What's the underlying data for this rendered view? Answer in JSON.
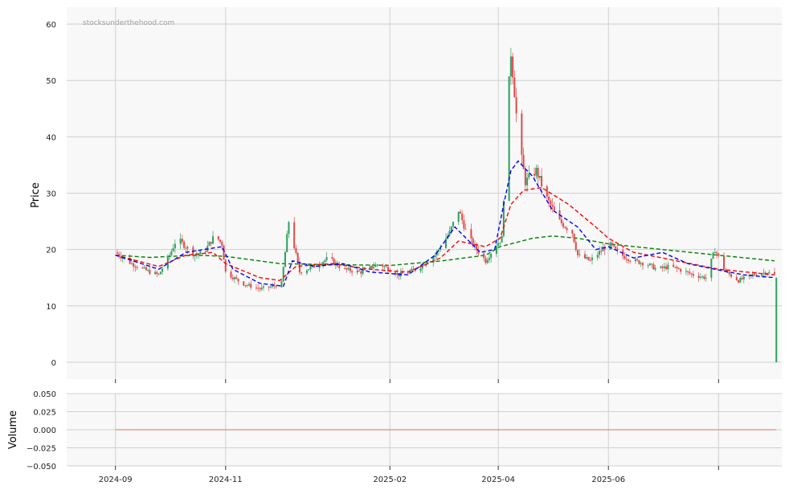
{
  "watermark": "stocksunderthehood.com",
  "chart_data": {
    "type": "candlestick",
    "price_panel": {
      "ylabel": "Price",
      "ylim": [
        -3,
        63
      ],
      "yticks": [
        0,
        10,
        20,
        30,
        40,
        50,
        60
      ],
      "grid": true
    },
    "volume_panel": {
      "ylabel": "Volume",
      "ylim": [
        -0.05,
        0.05
      ],
      "yticks": [
        "0.050",
        "0.025",
        "0.000",
        "−0.025",
        "−0.050"
      ],
      "ytick_values": [
        0.05,
        0.025,
        0.0,
        -0.025,
        -0.05
      ],
      "grid": true
    },
    "x_range": [
      "2024-08-05",
      "2025-09-05"
    ],
    "x_tick_labels": [
      "2024-09",
      "2024-11",
      "2025-02",
      "2025-04",
      "2025-06"
    ],
    "x_tick_dates": [
      "2024-09-01",
      "2024-11-01",
      "2025-01-31",
      "2025-04-01",
      "2025-06-01",
      "2025-08-01"
    ],
    "colors": {
      "up": "#2e9e5e",
      "down": "#e04848",
      "sma_green": "#008000",
      "sma_red": "#ff0000",
      "sma_blue": "#0000ff",
      "panel_bg": "#f8f8f8",
      "grid": "#d0d0d0"
    },
    "close_keypoints": [
      [
        "2024-09-01",
        19.5
      ],
      [
        "2024-09-10",
        17.5
      ],
      [
        "2024-09-20",
        16.0
      ],
      [
        "2024-09-25",
        15.5
      ],
      [
        "2024-10-01",
        19.0
      ],
      [
        "2024-10-05",
        22.0
      ],
      [
        "2024-10-10",
        20.5
      ],
      [
        "2024-10-15",
        19.0
      ],
      [
        "2024-10-20",
        19.5
      ],
      [
        "2024-10-26",
        22.5
      ],
      [
        "2024-10-30",
        21.0
      ],
      [
        "2024-11-01",
        16.0
      ],
      [
        "2024-11-10",
        14.0
      ],
      [
        "2024-11-20",
        13.0
      ],
      [
        "2024-11-28",
        13.5
      ],
      [
        "2024-12-02",
        14.0
      ],
      [
        "2024-12-06",
        25.0
      ],
      [
        "2024-12-12",
        16.0
      ],
      [
        "2024-12-20",
        17.0
      ],
      [
        "2024-12-28",
        18.5
      ],
      [
        "2025-01-05",
        16.5
      ],
      [
        "2025-01-15",
        16.0
      ],
      [
        "2025-01-25",
        17.5
      ],
      [
        "2025-02-05",
        15.5
      ],
      [
        "2025-02-15",
        16.5
      ],
      [
        "2025-02-25",
        19.0
      ],
      [
        "2025-03-05",
        23.0
      ],
      [
        "2025-03-10",
        27.0
      ],
      [
        "2025-03-15",
        22.5
      ],
      [
        "2025-03-20",
        20.0
      ],
      [
        "2025-03-25",
        18.0
      ],
      [
        "2025-03-30",
        20.5
      ],
      [
        "2025-04-03",
        22.0
      ],
      [
        "2025-04-06",
        44.0
      ],
      [
        "2025-04-08",
        55.0
      ],
      [
        "2025-04-10",
        48.0
      ],
      [
        "2025-04-12",
        40.0
      ],
      [
        "2025-04-16",
        32.0
      ],
      [
        "2025-04-22",
        34.0
      ],
      [
        "2025-04-28",
        29.0
      ],
      [
        "2025-05-05",
        25.0
      ],
      [
        "2025-05-12",
        23.0
      ],
      [
        "2025-05-15",
        19.0
      ],
      [
        "2025-05-22",
        18.0
      ],
      [
        "2025-06-01",
        21.0
      ],
      [
        "2025-06-08",
        19.0
      ],
      [
        "2025-06-15",
        18.0
      ],
      [
        "2025-06-22",
        17.5
      ],
      [
        "2025-06-28",
        16.5
      ],
      [
        "2025-07-05",
        17.0
      ],
      [
        "2025-07-10",
        16.5
      ],
      [
        "2025-07-18",
        15.5
      ],
      [
        "2025-07-25",
        15.0
      ],
      [
        "2025-07-30",
        20.0
      ],
      [
        "2025-08-05",
        16.0
      ],
      [
        "2025-08-12",
        14.5
      ],
      [
        "2025-08-20",
        15.5
      ],
      [
        "2025-08-28",
        16.0
      ],
      [
        "2025-09-01",
        15.5
      ]
    ],
    "last_candle": {
      "date": "2025-09-02",
      "open": 0.0,
      "high": 15.0,
      "low": 0.0,
      "close": 15.0
    },
    "sma_green": [
      [
        "2024-09-01",
        19.0
      ],
      [
        "2024-09-20",
        18.6
      ],
      [
        "2024-10-15",
        19.0
      ],
      [
        "2024-11-01",
        18.8
      ],
      [
        "2024-12-01",
        17.5
      ],
      [
        "2025-01-01",
        17.3
      ],
      [
        "2025-02-01",
        17.2
      ],
      [
        "2025-03-01",
        18.0
      ],
      [
        "2025-03-25",
        19.0
      ],
      [
        "2025-04-02",
        20.5
      ],
      [
        "2025-04-20",
        22.0
      ],
      [
        "2025-05-01",
        22.4
      ],
      [
        "2025-05-15",
        22.0
      ],
      [
        "2025-06-01",
        21.0
      ],
      [
        "2025-07-01",
        20.0
      ],
      [
        "2025-08-01",
        19.0
      ],
      [
        "2025-09-01",
        18.0
      ]
    ],
    "sma_red": [
      [
        "2024-09-01",
        19.0
      ],
      [
        "2024-09-25",
        17.0
      ],
      [
        "2024-10-10",
        19.0
      ],
      [
        "2024-10-25",
        19.5
      ],
      [
        "2024-11-01",
        17.5
      ],
      [
        "2024-11-20",
        15.0
      ],
      [
        "2024-12-01",
        14.5
      ],
      [
        "2024-12-10",
        17.0
      ],
      [
        "2024-12-30",
        17.5
      ],
      [
        "2025-01-20",
        16.5
      ],
      [
        "2025-02-10",
        16.0
      ],
      [
        "2025-02-28",
        18.5
      ],
      [
        "2025-03-10",
        21.5
      ],
      [
        "2025-03-25",
        20.5
      ],
      [
        "2025-04-02",
        22.0
      ],
      [
        "2025-04-08",
        28.0
      ],
      [
        "2025-04-15",
        30.5
      ],
      [
        "2025-04-25",
        31.0
      ],
      [
        "2025-05-10",
        28.0
      ],
      [
        "2025-05-25",
        24.0
      ],
      [
        "2025-06-01",
        22.0
      ],
      [
        "2025-06-15",
        19.5
      ],
      [
        "2025-07-01",
        18.5
      ],
      [
        "2025-08-01",
        16.5
      ],
      [
        "2025-09-01",
        15.5
      ]
    ],
    "sma_blue": [
      [
        "2024-09-01",
        19.0
      ],
      [
        "2024-09-25",
        16.5
      ],
      [
        "2024-10-10",
        19.5
      ],
      [
        "2024-10-30",
        20.5
      ],
      [
        "2024-11-05",
        16.5
      ],
      [
        "2024-11-20",
        14.0
      ],
      [
        "2024-12-03",
        13.5
      ],
      [
        "2024-12-08",
        18.0
      ],
      [
        "2024-12-20",
        17.0
      ],
      [
        "2025-01-05",
        17.5
      ],
      [
        "2025-01-20",
        16.0
      ],
      [
        "2025-02-10",
        15.5
      ],
      [
        "2025-02-25",
        19.0
      ],
      [
        "2025-03-08",
        24.0
      ],
      [
        "2025-03-22",
        19.5
      ],
      [
        "2025-03-30",
        20.0
      ],
      [
        "2025-04-04",
        28.0
      ],
      [
        "2025-04-08",
        34.0
      ],
      [
        "2025-04-12",
        35.7
      ],
      [
        "2025-04-20",
        33.0
      ],
      [
        "2025-05-01",
        27.0
      ],
      [
        "2025-05-15",
        24.0
      ],
      [
        "2025-05-25",
        20.0
      ],
      [
        "2025-06-01",
        20.5
      ],
      [
        "2025-06-15",
        18.5
      ],
      [
        "2025-07-01",
        19.5
      ],
      [
        "2025-07-15",
        17.5
      ],
      [
        "2025-07-30",
        16.5
      ],
      [
        "2025-08-15",
        15.5
      ],
      [
        "2025-09-01",
        15.0
      ]
    ]
  }
}
